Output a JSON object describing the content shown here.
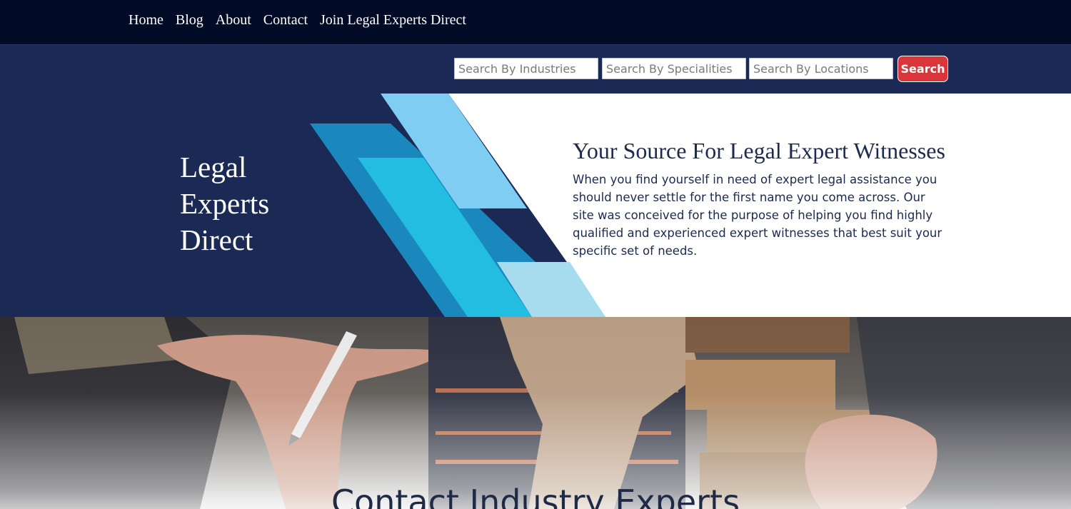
{
  "nav": {
    "items": [
      "Home",
      "Blog",
      "About",
      "Contact",
      "Join Legal Experts Direct"
    ]
  },
  "search": {
    "industries_placeholder": "Search By Industries",
    "specialities_placeholder": "Search By Specialities",
    "locations_placeholder": "Search By Locations",
    "button_label": "Search"
  },
  "hero": {
    "brand_line1": "Legal",
    "brand_line2": "Experts",
    "brand_line3": "Direct",
    "title": "Your Source For Legal Expert Witnesses",
    "description": "When you find yourself in need of expert legal assistance you should never settle for the first name you come across. Our site was conceived for the purpose of helping you find highly qualified and experienced expert witnesses that best suit your specific set of needs."
  },
  "section": {
    "title": "Contact Industry Experts"
  },
  "colors": {
    "nav_bg": "#020b26",
    "brand_navy": "#1a2a55",
    "search_button": "#d8363a",
    "accent_light_blue": "#7fcdf3",
    "accent_blue": "#1a87bd",
    "accent_cyan": "#22bde0",
    "accent_pale_blue": "#a6dcee"
  }
}
